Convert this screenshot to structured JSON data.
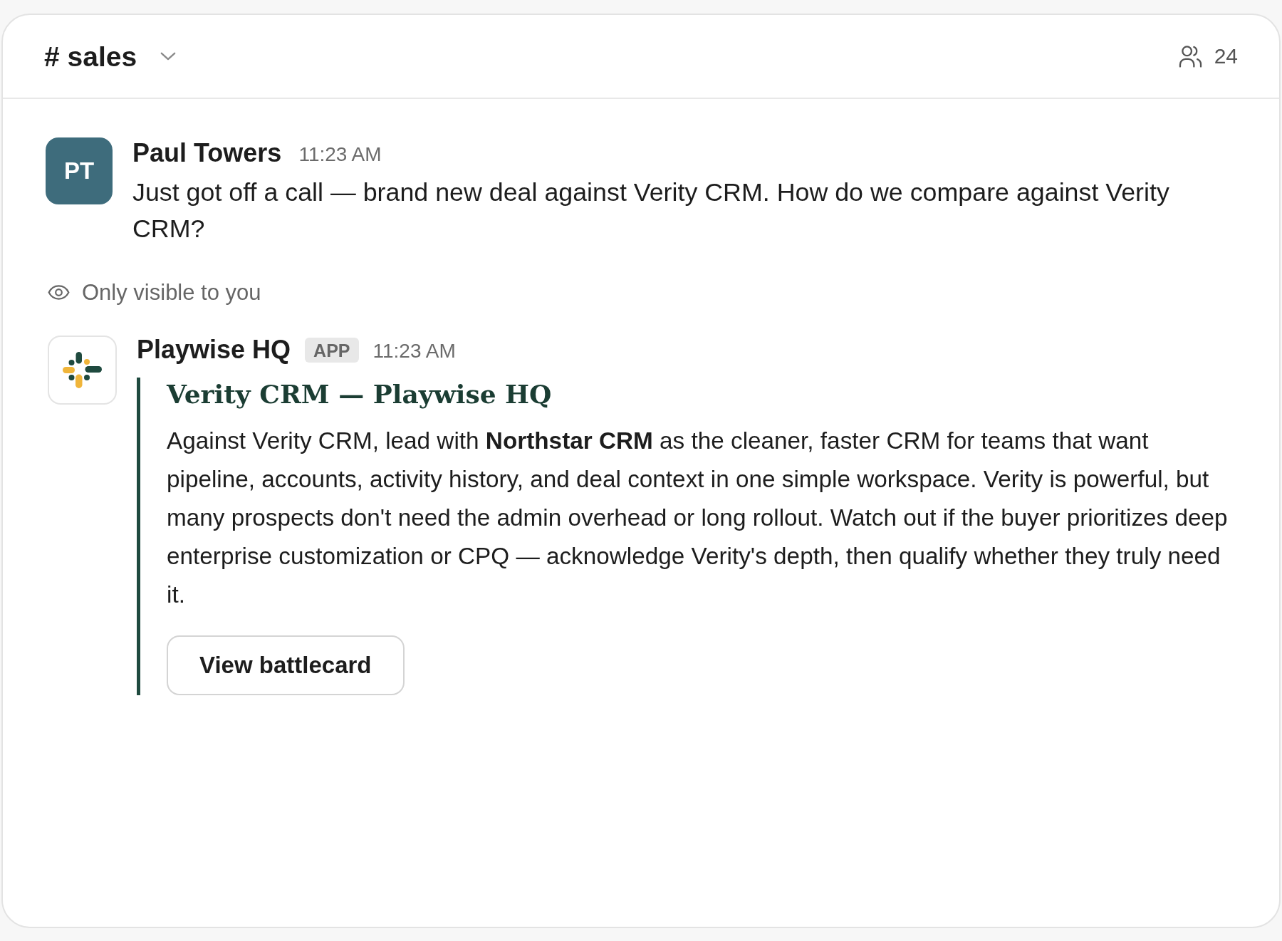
{
  "channel_header": {
    "title": "# sales",
    "member_count": "24"
  },
  "messages": [
    {
      "kind": "user",
      "avatar_initials": "PT",
      "author": "Paul Towers",
      "time": "11:23 AM",
      "text": "Just got off a call — brand new deal against Verity CRM. How do we compare against Verity CRM?"
    },
    {
      "kind": "notice",
      "text": "Only visible to you"
    },
    {
      "kind": "app",
      "author": "Playwise HQ",
      "badge": "APP",
      "time": "11:23 AM",
      "attachment": {
        "title": "Verity CRM — Playwise HQ",
        "body": "Against Verity CRM, lead with **Northstar CRM** as the cleaner, faster CRM for teams that want pipeline, accounts, activity history, and deal context in one simple workspace. Verity is powerful, but many prospects don't need the admin overhead or long rollout. Watch out if the buyer prioritizes deep enterprise customization or CPQ — acknowledge Verity's depth, then qualify whether they truly need it.",
        "button": "View battlecard"
      }
    }
  ]
}
